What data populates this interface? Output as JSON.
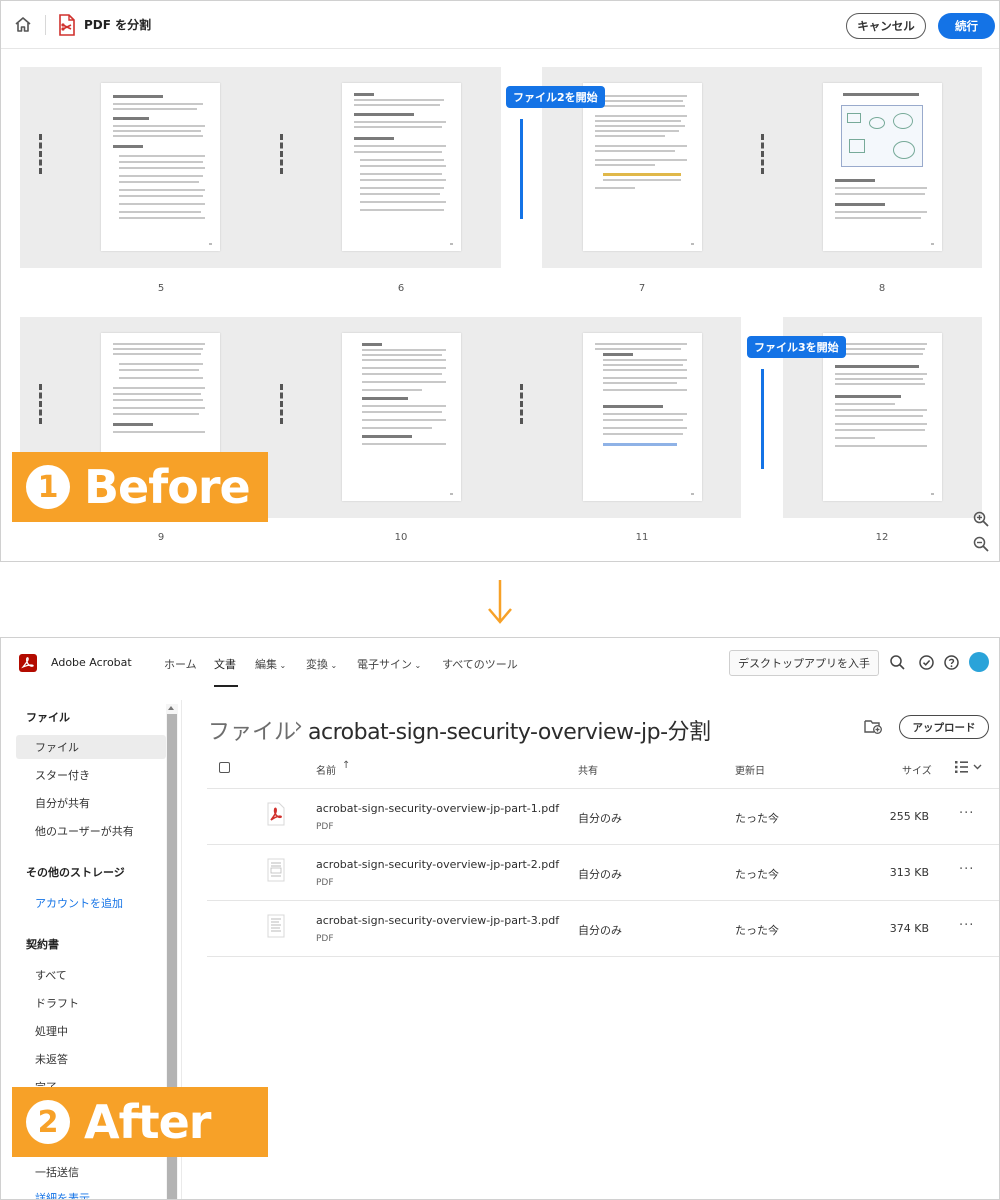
{
  "before": {
    "tool_title": "PDF を分割",
    "cancel_label": "キャンセル",
    "continue_label": "続行",
    "badge_file2": "ファイル2を開始",
    "badge_file3": "ファイル3を開始",
    "row1_pages": [
      "5",
      "6",
      "7",
      "8"
    ],
    "row2_pages": [
      "9",
      "10",
      "11",
      "12"
    ],
    "label_num": "1",
    "label_text": "Before"
  },
  "after": {
    "app_name": "Adobe Acrobat",
    "nav": [
      "ホーム",
      "文書",
      "編集",
      "変換",
      "電子サイン",
      "すべてのツール"
    ],
    "desktop_button": "デスクトップアプリを入手",
    "sidebar": {
      "section_files": "ファイル",
      "files_items": [
        "ファイル",
        "スター付き",
        "自分が共有",
        "他のユーザーが共有"
      ],
      "section_storage": "その他のストレージ",
      "add_account": "アカウントを追加",
      "section_agreements": "契約書",
      "agreement_items": [
        "すべて",
        "ドラフト",
        "処理中",
        "未返答",
        "完了",
        "一括送信"
      ],
      "more_link": "詳細を表示"
    },
    "breadcrumb_root": "ファイル",
    "breadcrumb_sep": "›",
    "breadcrumb_current": "acrobat-sign-security-overview-jp-分割",
    "upload_label": "アップロード",
    "headers": {
      "name": "名前",
      "shared": "共有",
      "modified": "更新日",
      "size": "サイズ"
    },
    "files": [
      {
        "name": "acrobat-sign-security-overview-jp-part-1.pdf",
        "type": "PDF",
        "shared": "自分のみ",
        "modified": "たった今",
        "size": "255 KB"
      },
      {
        "name": "acrobat-sign-security-overview-jp-part-2.pdf",
        "type": "PDF",
        "shared": "自分のみ",
        "modified": "たった今",
        "size": "313 KB"
      },
      {
        "name": "acrobat-sign-security-overview-jp-part-3.pdf",
        "type": "PDF",
        "shared": "自分のみ",
        "modified": "たった今",
        "size": "374 KB"
      }
    ],
    "more_dots": "···",
    "label_num": "2",
    "label_text": "After"
  },
  "colors": {
    "accent": "#1473e6",
    "label_orange": "#f7a128",
    "acrobat_red": "#b30b00"
  },
  "icons": [
    "home-icon",
    "split-pdf-icon",
    "zoom-in-icon",
    "zoom-out-icon",
    "arrow-down-icon",
    "search-icon",
    "check-circle-icon",
    "help-icon",
    "new-folder-icon",
    "list-view-icon",
    "pdf-file-icon"
  ]
}
